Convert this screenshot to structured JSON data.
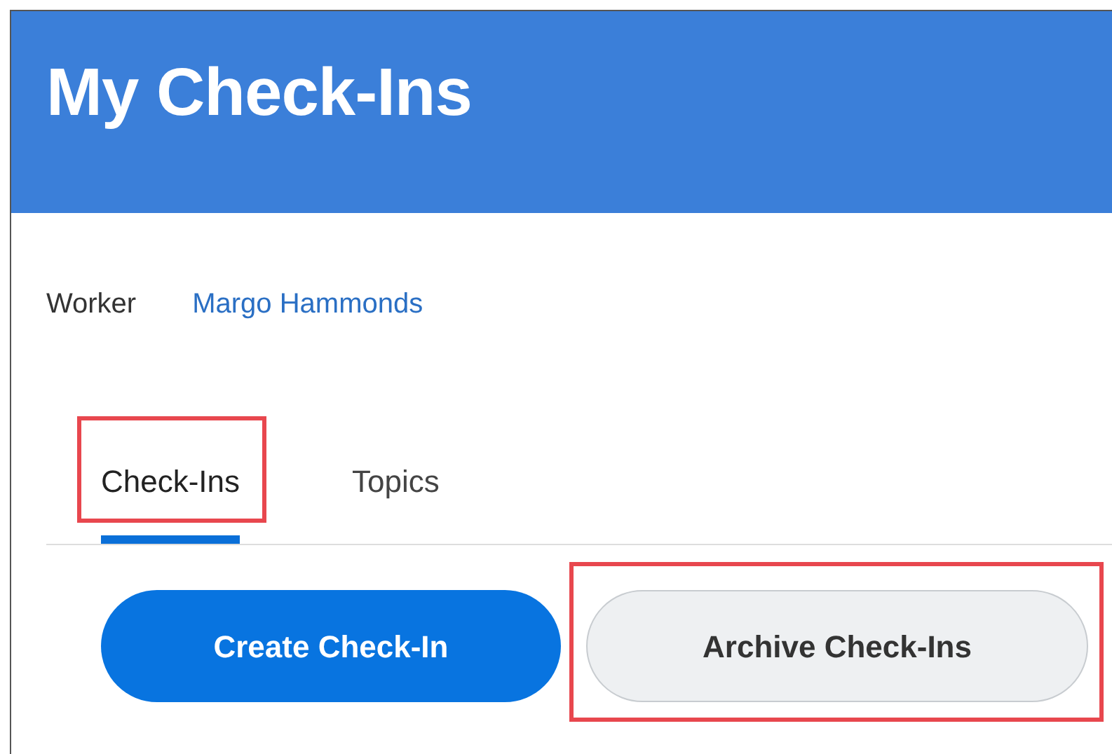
{
  "header": {
    "title": "My Check-Ins"
  },
  "worker": {
    "label": "Worker",
    "name": "Margo Hammonds"
  },
  "tabs": [
    {
      "label": "Check-Ins",
      "selected": true,
      "highlighted": true
    },
    {
      "label": "Topics",
      "selected": false,
      "highlighted": false
    }
  ],
  "buttons": [
    {
      "label": "Create Check-In",
      "kind": "primary",
      "highlighted": false
    },
    {
      "label": "Archive Check-Ins",
      "kind": "secondary",
      "highlighted": true
    }
  ]
}
